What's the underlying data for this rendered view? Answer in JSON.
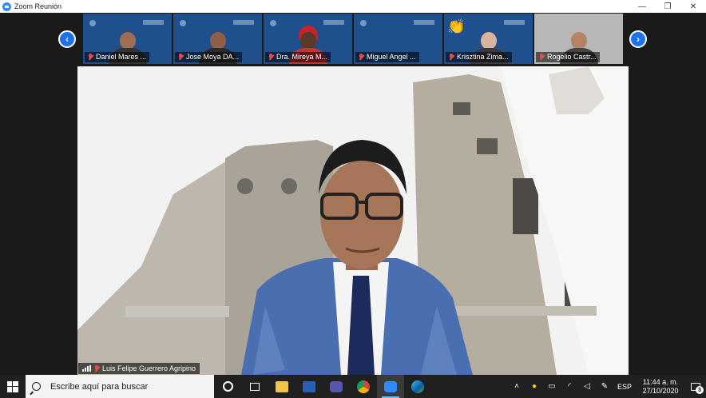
{
  "window": {
    "title": "Zoom Reunión",
    "minimize_glyph": "—",
    "maximize_glyph": "❐",
    "close_glyph": "✕"
  },
  "thumbnail_strip": {
    "prev_glyph": "‹",
    "next_glyph": "›",
    "participants": [
      {
        "name": "Daniel Mares ...",
        "muted": true
      },
      {
        "name": "Jose Moya DA...",
        "muted": true
      },
      {
        "name": "Dra. Mireya M...",
        "muted": true
      },
      {
        "name": "Miguel Angel ...",
        "muted": true
      },
      {
        "name": "Krisztina Zima...",
        "muted": true,
        "reaction": "👏"
      },
      {
        "name": "Rogelio Castr...",
        "muted": true
      }
    ]
  },
  "speaker": {
    "name": "Luis Felipe Guerrero Agripino",
    "muted": true
  },
  "taskbar": {
    "search_placeholder": "Escribe aquí para buscar",
    "language": "ESP",
    "time": "11:44 a. m.",
    "date": "27/10/2020",
    "notifications": "3"
  },
  "colors": {
    "zoom_blue": "#2d8cff",
    "arrow_blue": "#1e72ea",
    "thumb_bg": "#1f4f8c",
    "taskbar": "#202020",
    "muted_red": "#e64a4a"
  }
}
